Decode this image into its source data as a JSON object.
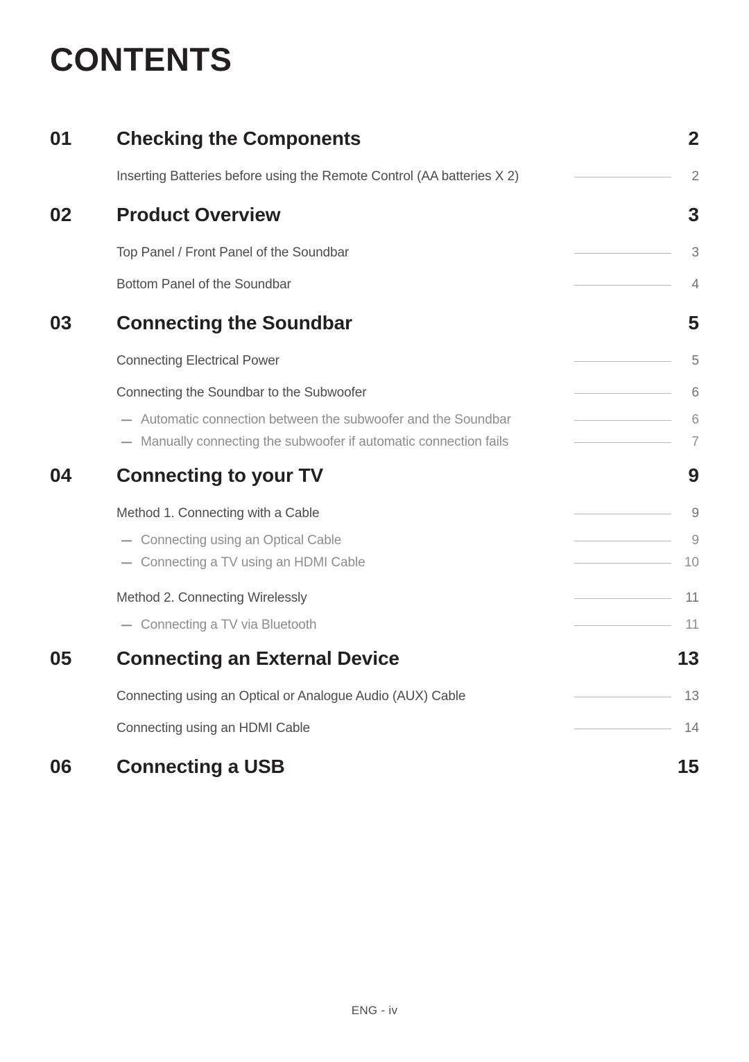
{
  "document": {
    "title": "CONTENTS",
    "footer": "ENG - iv"
  },
  "sections": [
    {
      "number": "01",
      "title": "Checking the Components",
      "page": "2",
      "entries": [
        {
          "level": 2,
          "label": "Inserting Batteries before using the Remote Control (AA batteries X 2)",
          "page": "2"
        }
      ]
    },
    {
      "number": "02",
      "title": "Product Overview",
      "page": "3",
      "entries": [
        {
          "level": 2,
          "label": "Top Panel / Front Panel of the Soundbar",
          "page": "3"
        },
        {
          "level": 2,
          "label": "Bottom Panel of the Soundbar",
          "page": "4"
        }
      ]
    },
    {
      "number": "03",
      "title": "Connecting the Soundbar",
      "page": "5",
      "entries": [
        {
          "level": 2,
          "label": "Connecting Electrical Power",
          "page": "5"
        },
        {
          "level": 2,
          "label": "Connecting the Soundbar to the Subwoofer",
          "page": "6"
        },
        {
          "level": 3,
          "label": "Automatic connection between the subwoofer and the Soundbar",
          "page": "6"
        },
        {
          "level": 3,
          "label": "Manually connecting the subwoofer if automatic connection fails",
          "page": "7"
        }
      ]
    },
    {
      "number": "04",
      "title": "Connecting to your TV",
      "page": "9",
      "entries": [
        {
          "level": 2,
          "label": "Method 1. Connecting with a Cable",
          "page": "9"
        },
        {
          "level": 3,
          "label": "Connecting using an Optical Cable",
          "page": "9"
        },
        {
          "level": 3,
          "label": "Connecting a TV using an HDMI Cable",
          "page": "10"
        },
        {
          "level": 2,
          "label": "Method 2. Connecting Wirelessly",
          "page": "11"
        },
        {
          "level": 3,
          "label": "Connecting a TV via Bluetooth",
          "page": "11"
        }
      ]
    },
    {
      "number": "05",
      "title": "Connecting an External Device",
      "page": "13",
      "entries": [
        {
          "level": 2,
          "label": "Connecting using an Optical or Analogue Audio (AUX) Cable",
          "page": "13"
        },
        {
          "level": 2,
          "label": "Connecting using an HDMI Cable",
          "page": "14"
        }
      ]
    },
    {
      "number": "06",
      "title": "Connecting a USB",
      "page": "15",
      "entries": []
    }
  ],
  "colors": {
    "heading": "#231f20",
    "entry_level2": "#4a4a4f",
    "entry_level3": "#8b8b92",
    "leader_line": "#b5b5bb",
    "background": "#ffffff"
  }
}
